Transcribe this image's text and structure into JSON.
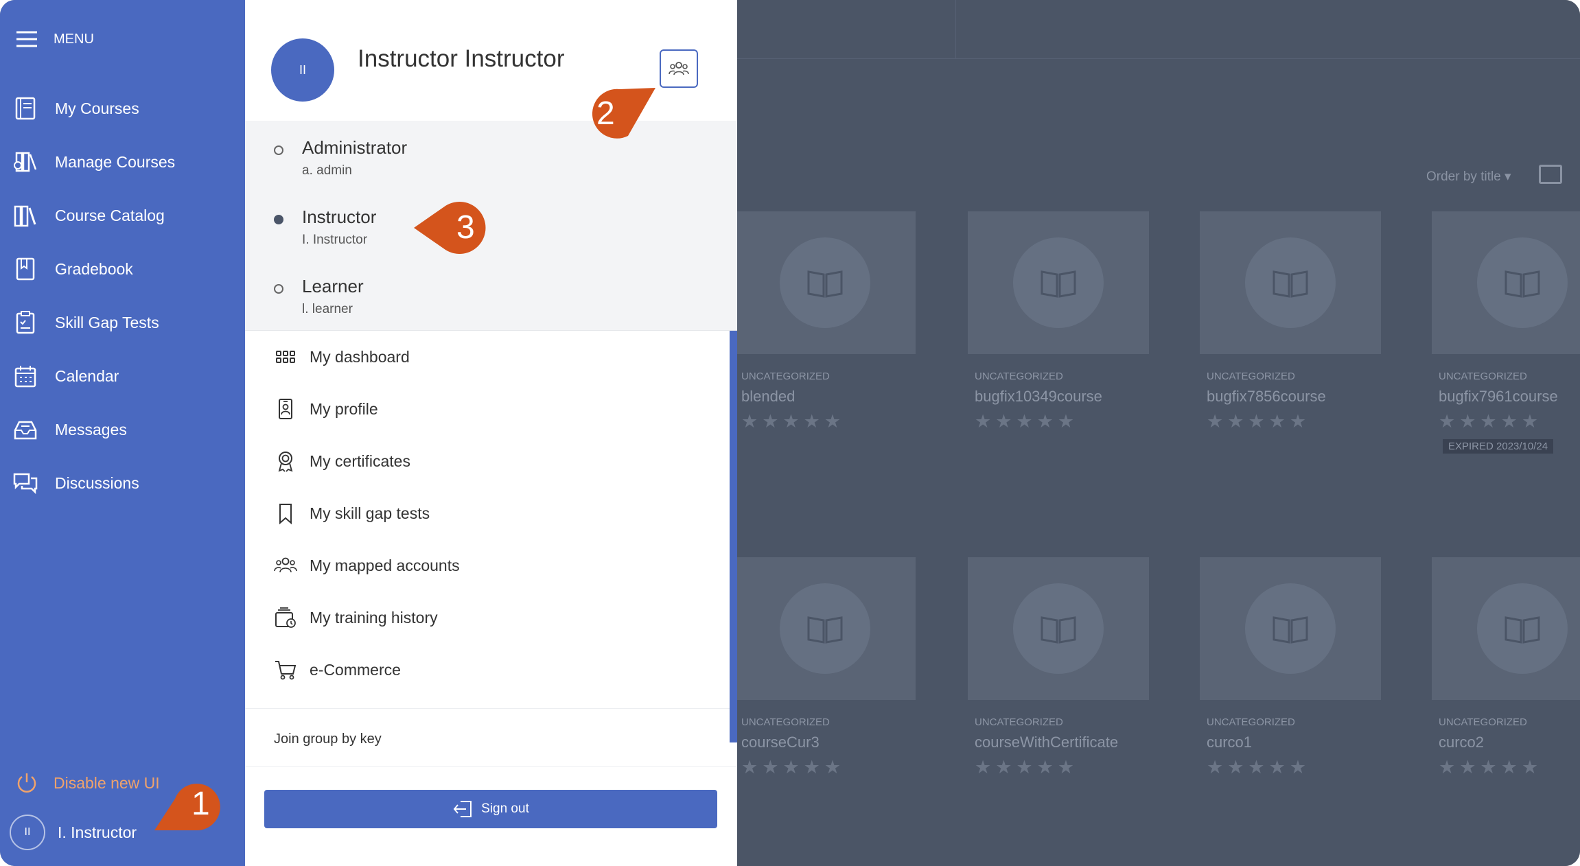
{
  "sidebar": {
    "menu_label": "MENU",
    "items": [
      {
        "label": "My Courses",
        "icon": "book-icon"
      },
      {
        "label": "Manage Courses",
        "icon": "manage-courses-icon"
      },
      {
        "label": "Course Catalog",
        "icon": "catalog-icon"
      },
      {
        "label": "Gradebook",
        "icon": "gradebook-icon"
      },
      {
        "label": "Skill Gap Tests",
        "icon": "clipboard-icon"
      },
      {
        "label": "Calendar",
        "icon": "calendar-icon"
      },
      {
        "label": "Messages",
        "icon": "inbox-icon"
      },
      {
        "label": "Discussions",
        "icon": "chat-icon"
      }
    ],
    "disable_ui_label": "Disable new UI",
    "user_label": "I. Instructor",
    "user_initials": "II"
  },
  "panel": {
    "user_name": "Instructor Instructor",
    "avatar_initials": "II",
    "roles": [
      {
        "name": "Administrator",
        "sub": "a. admin",
        "selected": false
      },
      {
        "name": "Instructor",
        "sub": "I. Instructor",
        "selected": true
      },
      {
        "name": "Learner",
        "sub": "l. learner",
        "selected": false
      }
    ],
    "links": [
      {
        "label": "My dashboard",
        "icon": "dashboard-grid-icon"
      },
      {
        "label": "My profile",
        "icon": "profile-badge-icon"
      },
      {
        "label": "My certificates",
        "icon": "certificate-icon"
      },
      {
        "label": "My skill gap tests",
        "icon": "bookmark-icon"
      },
      {
        "label": "My mapped accounts",
        "icon": "users-group-icon"
      },
      {
        "label": "My training history",
        "icon": "training-history-icon"
      },
      {
        "label": "e-Commerce",
        "icon": "cart-icon"
      }
    ],
    "join_label": "Join group by key",
    "signout_label": "Sign out"
  },
  "background": {
    "order_label": "Order by title",
    "cards": [
      {
        "category": "UNCATEGORIZED",
        "title": "blended",
        "expired": ""
      },
      {
        "category": "UNCATEGORIZED",
        "title": "bugfix10349course",
        "expired": ""
      },
      {
        "category": "UNCATEGORIZED",
        "title": "bugfix7856course",
        "expired": ""
      },
      {
        "category": "UNCATEGORIZED",
        "title": "bugfix7961course",
        "expired": "EXPIRED 2023/10/24"
      },
      {
        "category": "UNCATEGORIZED",
        "title": "courseCur3",
        "expired": ""
      },
      {
        "category": "UNCATEGORIZED",
        "title": "courseWithCertificate",
        "expired": ""
      },
      {
        "category": "UNCATEGORIZED",
        "title": "curco1",
        "expired": ""
      },
      {
        "category": "UNCATEGORIZED",
        "title": "curco2",
        "expired": ""
      }
    ],
    "stars": "★★★★★"
  },
  "callouts": [
    "1",
    "2",
    "3"
  ],
  "colors": {
    "accent": "#4a69c0",
    "callout": "#d4541c",
    "overlay": "#4b5566"
  }
}
